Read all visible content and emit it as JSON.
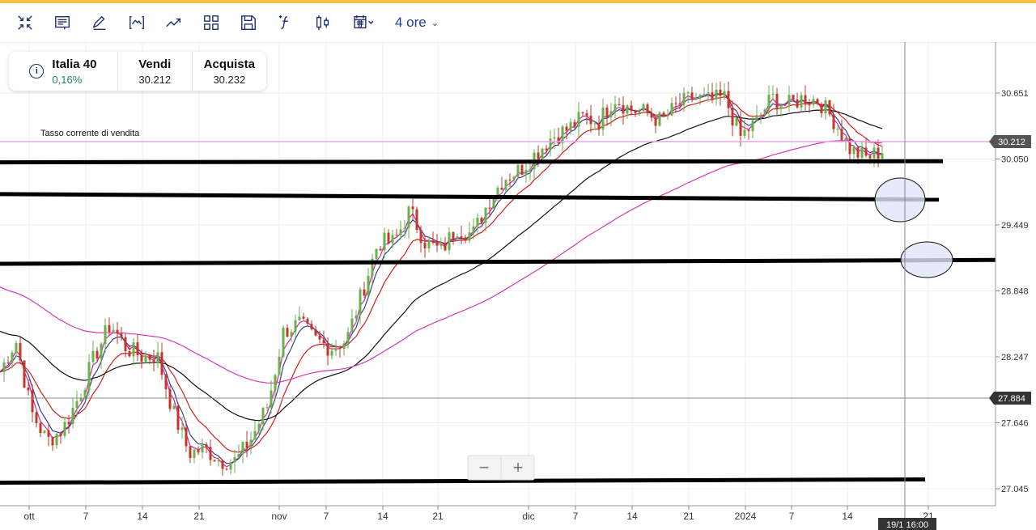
{
  "toolbar": {
    "icons": [
      "collapse-icon",
      "comment-icon",
      "pencil-icon",
      "indicator-icon",
      "trend-icon",
      "layout-icon",
      "save-icon",
      "function-icon",
      "candle-icon",
      "calendar-icon"
    ],
    "period": "4 ore"
  },
  "instrument": {
    "name": "Italia 40",
    "change": "0,16%",
    "change_color": "#1a8a4a",
    "sell_label": "Vendi",
    "sell": "30.212",
    "buy_label": "Acquista",
    "buy": "30.232"
  },
  "rate_label": "Tasso corrente di vendita",
  "price_ticks": [
    "30.651",
    "30.050",
    "29.449",
    "28.848",
    "28.247",
    "27.646",
    "27.045"
  ],
  "current_price": "30.212",
  "crosshair_price": "27.884",
  "crosshair_time": "19/1 16:00",
  "date_ticks": [
    "ott",
    "7",
    "14",
    "21",
    "nov",
    "7",
    "14",
    "21",
    "dic",
    "7",
    "14",
    "21",
    "2024",
    "7",
    "14",
    "21"
  ],
  "chart_data": {
    "type": "candlestick",
    "closes": [
      28.11,
      28.4,
      27.74,
      27.48,
      27.59,
      27.88,
      28.25,
      28.55,
      28.33,
      28.25,
      28.25,
      27.74,
      27.37,
      27.41,
      27.3,
      27.3,
      27.52,
      27.81,
      28.48,
      28.55,
      28.4,
      28.33,
      28.4,
      28.84,
      29.29,
      29.29,
      29.58,
      29.29,
      29.21,
      29.43,
      29.36,
      29.66,
      29.88,
      29.95,
      30.1,
      30.25,
      30.32,
      30.43,
      30.39,
      30.61,
      30.5,
      30.47,
      30.39,
      30.54,
      30.61,
      30.58,
      30.61,
      30.25,
      30.39,
      30.61,
      30.54,
      30.61,
      30.58,
      30.39,
      30.13,
      30.06,
      30.13
    ],
    "support_lines": [
      [
        30.02,
        30.03
      ],
      [
        29.73,
        29.68
      ],
      [
        29.095,
        29.13
      ],
      [
        27.1,
        27.13
      ]
    ],
    "colors": {
      "up": "#6ab04c",
      "down": "#c0392b",
      "ma_fast": "#d6249f",
      "ma_mid": "#3b3b8f",
      "ma_red": "#d0201c",
      "ma_black": "#111111",
      "ma_pink": "#d63ab5"
    }
  }
}
